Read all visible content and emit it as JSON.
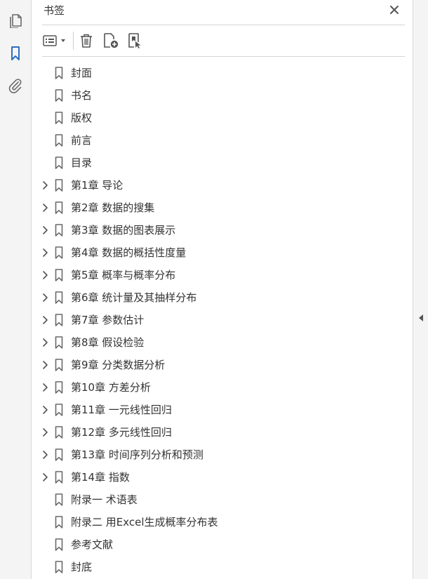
{
  "panel": {
    "title": "书签"
  },
  "icons": {
    "rail_pages": "pages-icon",
    "rail_bookmarks": "bookmark-icon",
    "rail_attachments": "paperclip-icon",
    "close": "close-icon",
    "options": "options-menu-icon",
    "delete": "trash-icon",
    "new_bookmark": "new-bookmark-icon",
    "bookmark_from_structure": "bookmark-structure-icon",
    "expand": "chevron-right-icon",
    "collapse_panel": "triangle-left-icon"
  },
  "colors": {
    "accent": "#2b6fc2",
    "icon": "#6a6a6a",
    "text": "#333333",
    "rail": "#f4f4f4"
  },
  "bookmarks": [
    {
      "label": "封面",
      "expandable": false
    },
    {
      "label": "书名",
      "expandable": false
    },
    {
      "label": "版权",
      "expandable": false
    },
    {
      "label": "前言",
      "expandable": false
    },
    {
      "label": "目录",
      "expandable": false
    },
    {
      "label": "第1章  导论",
      "expandable": true
    },
    {
      "label": "第2章  数据的搜集",
      "expandable": true
    },
    {
      "label": "第3章  数据的图表展示",
      "expandable": true
    },
    {
      "label": "第4章  数据的概括性度量",
      "expandable": true
    },
    {
      "label": "第5章  概率与概率分布",
      "expandable": true
    },
    {
      "label": "第6章  统计量及其抽样分布",
      "expandable": true
    },
    {
      "label": "第7章  参数估计",
      "expandable": true
    },
    {
      "label": "第8章  假设检验",
      "expandable": true
    },
    {
      "label": "第9章  分类数据分析",
      "expandable": true
    },
    {
      "label": "第10章  方差分析",
      "expandable": true
    },
    {
      "label": "第11章  一元线性回归",
      "expandable": true
    },
    {
      "label": "第12章  多元线性回归",
      "expandable": true
    },
    {
      "label": "第13章  时间序列分析和预测",
      "expandable": true
    },
    {
      "label": "第14章  指数",
      "expandable": true
    },
    {
      "label": "附录一  术语表",
      "expandable": false
    },
    {
      "label": "附录二  用Excel生成概率分布表",
      "expandable": false
    },
    {
      "label": "参考文献",
      "expandable": false
    },
    {
      "label": "封底",
      "expandable": false
    }
  ]
}
